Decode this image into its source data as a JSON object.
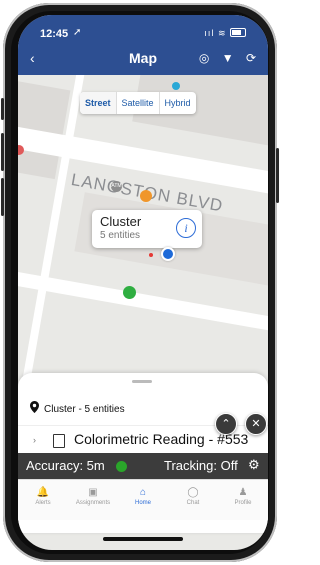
{
  "status": {
    "time": "12:45",
    "location_arrow": "➚",
    "signal": "ııl",
    "wifi": "≋"
  },
  "nav": {
    "back_glyph": "‹",
    "title": "Map",
    "icons": [
      "target-icon",
      "filter-icon",
      "refresh-icon"
    ],
    "icon_glyphs": [
      "◎",
      "▼",
      "⟳"
    ]
  },
  "map": {
    "map_types": [
      "Street",
      "Satellite",
      "Hybrid"
    ],
    "selected_map_type": "Street",
    "street_name": "LANGSTON BLVD",
    "poi_atm": "ATM",
    "cluster": {
      "title": "Cluster",
      "subtitle": "5 entities",
      "info_glyph": "i"
    }
  },
  "sheet": {
    "title": "Cluster - 5 entities",
    "reading": {
      "chevron": "›",
      "label": "Colorimetric Reading - #553"
    },
    "fab_up": "⌃",
    "fab_close": "✕"
  },
  "status_bar": {
    "accuracy_label": "Accuracy: 5m",
    "tracking_label": "Tracking: Off",
    "accuracy_color": "#2aa52a",
    "gear_glyph": "⚙"
  },
  "tabs": [
    {
      "label": "Alerts",
      "icon": "bell-icon",
      "glyph": "🔔",
      "active": false
    },
    {
      "label": "Assignments",
      "icon": "documents-icon",
      "glyph": "▣",
      "active": false
    },
    {
      "label": "Home",
      "icon": "home-icon",
      "glyph": "⌂",
      "active": true
    },
    {
      "label": "Chat",
      "icon": "chat-icon",
      "glyph": "◯",
      "active": false
    },
    {
      "label": "Profile",
      "icon": "person-icon",
      "glyph": "♟",
      "active": false
    }
  ],
  "colors": {
    "header": "#2d4f92",
    "accent": "#2d6cd6",
    "bar": "#3c3c3c"
  }
}
